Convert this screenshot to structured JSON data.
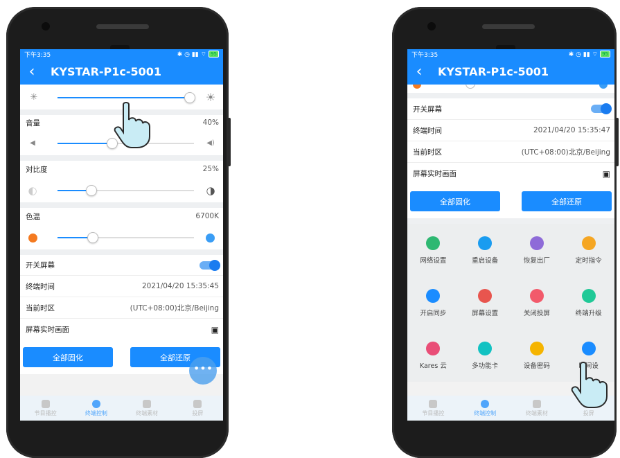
{
  "phone_left": {
    "status": {
      "time": "下午3:35",
      "icons": "✱ ◷ ▮▮ ⌔",
      "battery": "95"
    },
    "header": {
      "title": "KYSTAR-P1c-5001",
      "back_icon": "‹"
    },
    "brightness": {
      "level": 0.97
    },
    "volume": {
      "label": "音量",
      "value": "40%",
      "level": 0.4
    },
    "contrast": {
      "label": "对比度",
      "value": "25%",
      "level": 0.25
    },
    "color_temp": {
      "label": "色温",
      "value": "6700K",
      "level": 0.26,
      "warm_color": "#f47a20",
      "cool_color": "#3a9df5"
    },
    "screen_switch": {
      "label": "开关屏幕"
    },
    "terminal_time": {
      "label": "终端时间",
      "value": "2021/04/20 15:35:45"
    },
    "timezone": {
      "label": "当前时区",
      "value": "(UTC+08:00)北京/Beijing"
    },
    "realtime": {
      "label": "屏幕实时画面"
    },
    "buttons": {
      "solidify_all": "全部固化",
      "restore_all": "全部还原"
    },
    "fab": "•••",
    "nav": [
      "节目播控",
      "终端控制",
      "终端素材",
      "投屏"
    ]
  },
  "phone_right": {
    "status": {
      "time": "下午3:35",
      "icons": "✱ ◷ ▮▮ ⌔",
      "battery": "95"
    },
    "header": {
      "title": "KYSTAR-P1c-5001",
      "back_icon": "‹"
    },
    "screen_switch": {
      "label": "开关屏幕"
    },
    "terminal_time": {
      "label": "终端时间",
      "value": "2021/04/20 15:35:47"
    },
    "timezone": {
      "label": "当前时区",
      "value": "(UTC+08:00)北京/Beijing"
    },
    "realtime": {
      "label": "屏幕实时画面"
    },
    "buttons": {
      "solidify_all": "全部固化",
      "restore_all": "全部还原"
    },
    "grid": [
      {
        "label": "网络设置",
        "icon": "network-icon",
        "color": "#2eb872"
      },
      {
        "label": "重启设备",
        "icon": "power-icon",
        "color": "#1a9cf0"
      },
      {
        "label": "恢复出厂",
        "icon": "factory-reset-icon",
        "color": "#8e6bd8"
      },
      {
        "label": "定时指令",
        "icon": "alarm-icon",
        "color": "#f5a623"
      },
      {
        "label": "开启同步",
        "icon": "sync-icon",
        "color": "#1a8cff"
      },
      {
        "label": "屏幕设置",
        "icon": "screen-settings-icon",
        "color": "#e8554e"
      },
      {
        "label": "关闭投屏",
        "icon": "close-cast-icon",
        "color": "#f25a6b"
      },
      {
        "label": "终端升级",
        "icon": "upgrade-icon",
        "color": "#20c997"
      },
      {
        "label": "Kares 云",
        "icon": "kares-cloud-icon",
        "color": "#e94e77"
      },
      {
        "label": "多功能卡",
        "icon": "multi-card-icon",
        "color": "#12c2c2"
      },
      {
        "label": "设备密码",
        "icon": "lock-icon",
        "color": "#f5b400"
      },
      {
        "label": "时间设",
        "icon": "clock-icon",
        "color": "#1a8cff"
      }
    ],
    "nav": [
      "节目播控",
      "终端控制",
      "终端素材",
      "投屏"
    ]
  }
}
